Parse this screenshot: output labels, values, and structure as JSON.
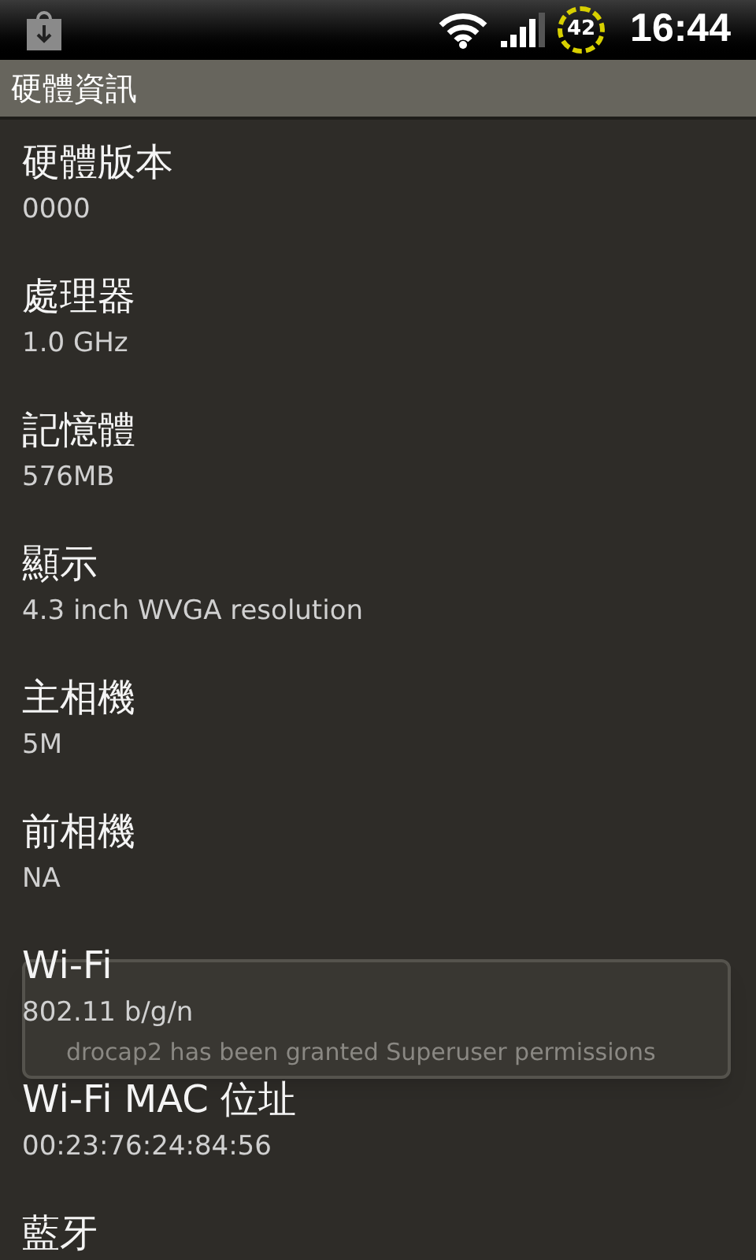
{
  "status_bar": {
    "battery": "42",
    "time": "16:44"
  },
  "title": "硬體資訊",
  "items": [
    {
      "title": "硬體版本",
      "value": "0000"
    },
    {
      "title": "處理器",
      "value": "1.0 GHz"
    },
    {
      "title": "記憶體",
      "value": "576MB"
    },
    {
      "title": "顯示",
      "value": "4.3 inch WVGA resolution"
    },
    {
      "title": "主相機",
      "value": "5M"
    },
    {
      "title": "前相機",
      "value": "NA"
    },
    {
      "title": "Wi-Fi",
      "value": "802.11 b/g/n"
    },
    {
      "title": "Wi-Fi MAC 位址",
      "value": "00:23:76:24:84:56"
    },
    {
      "title": "藍牙"
    }
  ],
  "toast": {
    "message": "drocap2 has been granted Superuser permissions"
  }
}
